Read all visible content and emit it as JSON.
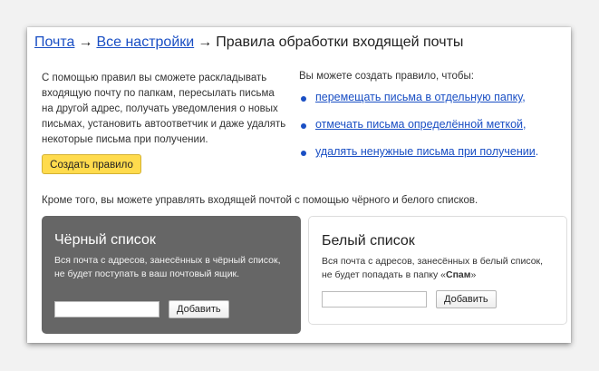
{
  "breadcrumb": {
    "mail": "Почта",
    "arrow": "→",
    "all_settings": "Все настройки",
    "current": "Правила обработки входящей почты"
  },
  "intro": "С помощью правил вы сможете раскладывать входящую почту по папкам, пересылать письма на другой адрес, получать уведомления о новых письмах, установить автоответчик и даже удалять некоторые письма при получении.",
  "create_button": "Создать правило",
  "you_can": "Вы можете создать правило, чтобы:",
  "actions": [
    {
      "link": "перемещать письма в отдельную папку",
      "tail": ","
    },
    {
      "link": "отмечать письма определённой меткой",
      "tail": ","
    },
    {
      "link": "удалять ненужные письма при получении",
      "tail": "."
    }
  ],
  "also": "Кроме того, вы можете управлять входящей почтой с помощью чёрного и белого списков.",
  "black_list": {
    "title": "Чёрный список",
    "description": "Вся почта с адресов, занесённых в чёрный список, не будет поступать в ваш почтовый ящик.",
    "input_value": "",
    "button": "Добавить"
  },
  "white_list": {
    "title": "Белый список",
    "description_start": "Вся почта с адресов, занесённых в белый список, не будет попадать в папку «",
    "spam": "Спам",
    "description_end": "»",
    "input_value": "",
    "button": "Добавить"
  },
  "colors": {
    "link": "#1a4fc4",
    "button_yellow": "#ffdb4d",
    "black_box": "#666666"
  }
}
